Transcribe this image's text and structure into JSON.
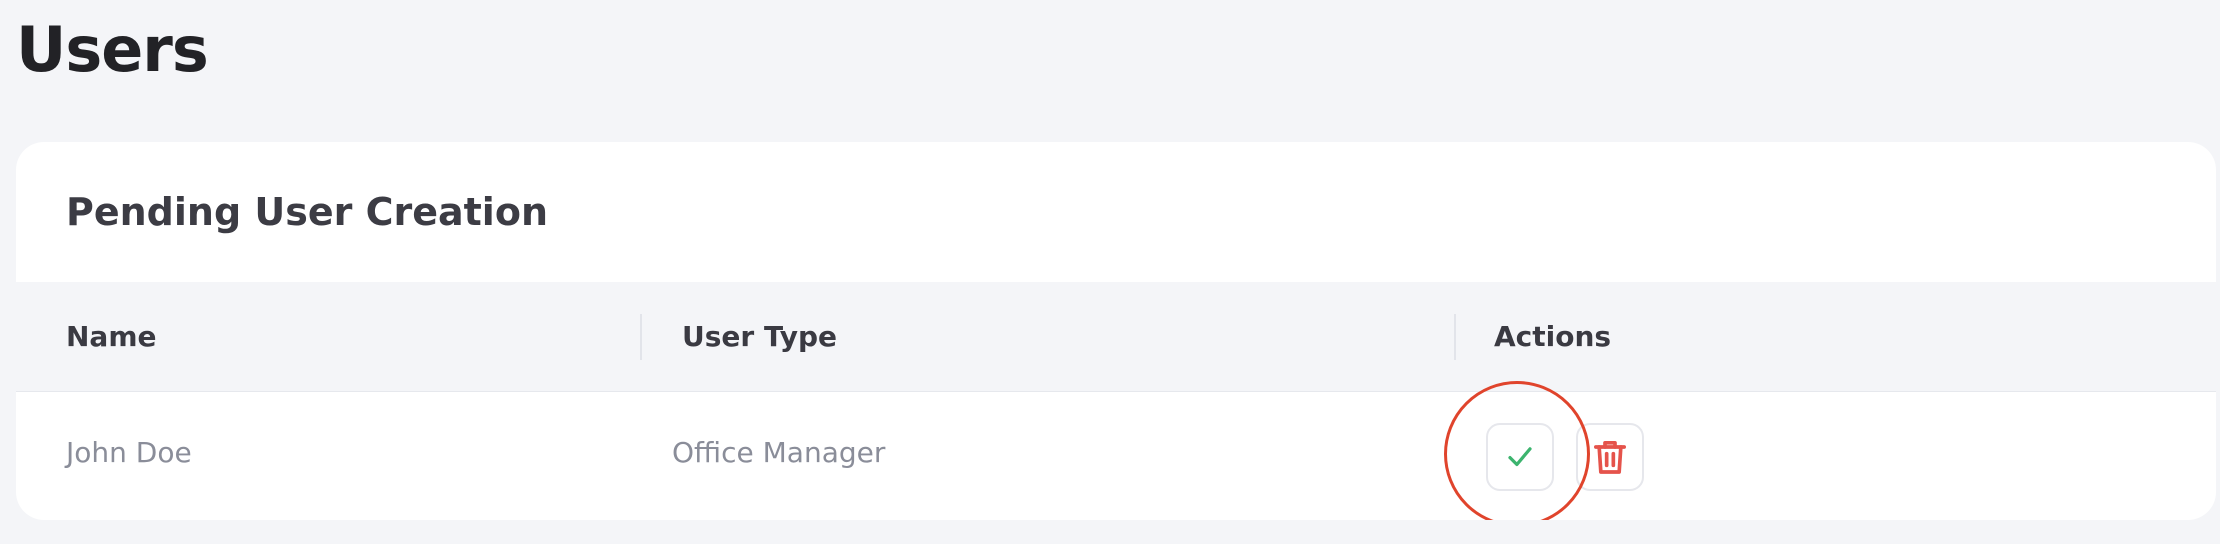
{
  "page": {
    "title": "Users"
  },
  "pending_card": {
    "title": "Pending User Creation",
    "columns": {
      "name": "Name",
      "user_type": "User Type",
      "actions": "Actions"
    },
    "rows": [
      {
        "name": "John Doe",
        "user_type": "Office Manager",
        "approve_icon": "check-icon",
        "delete_icon": "trash-icon"
      }
    ]
  },
  "colors": {
    "page_background": "#f4f5f8",
    "approve_green": "#3cb46e",
    "delete_red": "#e5534b",
    "highlight_red": "#e0442c"
  }
}
